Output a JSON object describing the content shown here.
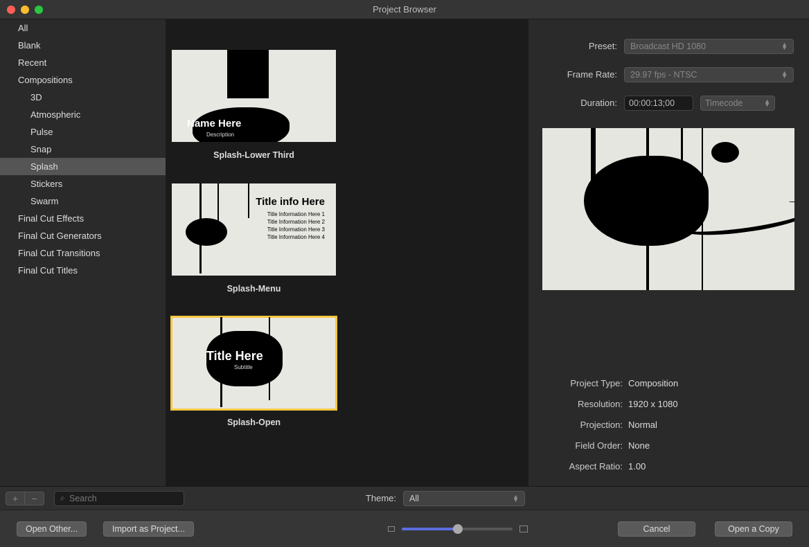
{
  "window": {
    "title": "Project Browser"
  },
  "sidebar": {
    "items": [
      {
        "label": "All",
        "child": false
      },
      {
        "label": "Blank",
        "child": false
      },
      {
        "label": "Recent",
        "child": false
      },
      {
        "label": "Compositions",
        "child": false
      },
      {
        "label": "3D",
        "child": true
      },
      {
        "label": "Atmospheric",
        "child": true
      },
      {
        "label": "Pulse",
        "child": true
      },
      {
        "label": "Snap",
        "child": true
      },
      {
        "label": "Splash",
        "child": true,
        "selected": true
      },
      {
        "label": "Stickers",
        "child": true
      },
      {
        "label": "Swarm",
        "child": true
      },
      {
        "label": "Final Cut Effects",
        "child": false
      },
      {
        "label": "Final Cut Generators",
        "child": false
      },
      {
        "label": "Final Cut Transitions",
        "child": false
      },
      {
        "label": "Final Cut Titles",
        "child": false
      }
    ]
  },
  "gallery": {
    "items": [
      {
        "label": "Splash-Lower Third",
        "thumb_title": "Name Here",
        "thumb_sub": "Description"
      },
      {
        "label": "Splash-Menu",
        "thumb_title": "Title info Here",
        "thumb_lines": [
          "Title Information Here 1",
          "Title Information Here 2",
          "Title Information Here 3",
          "Title Information Here 4"
        ]
      },
      {
        "label": "Splash-Open",
        "thumb_title": "Title Here",
        "thumb_sub": "Subtitle",
        "selected": true
      }
    ]
  },
  "inspector": {
    "preset_label": "Preset:",
    "preset_value": "Broadcast HD 1080",
    "framerate_label": "Frame Rate:",
    "framerate_value": "29.97 fps - NTSC",
    "duration_label": "Duration:",
    "duration_value": "00:00:13;00",
    "timecode_label": "Timecode",
    "meta": {
      "project_type_label": "Project Type:",
      "project_type_value": "Composition",
      "resolution_label": "Resolution:",
      "resolution_value": "1920 x 1080",
      "projection_label": "Projection:",
      "projection_value": "Normal",
      "field_order_label": "Field Order:",
      "field_order_value": "None",
      "aspect_label": "Aspect Ratio:",
      "aspect_value": "1.00"
    }
  },
  "toolbar": {
    "search_placeholder": "Search",
    "theme_label": "Theme:",
    "theme_value": "All"
  },
  "footer": {
    "open_other": "Open Other...",
    "import_project": "Import as Project...",
    "cancel": "Cancel",
    "open_copy": "Open a Copy"
  }
}
